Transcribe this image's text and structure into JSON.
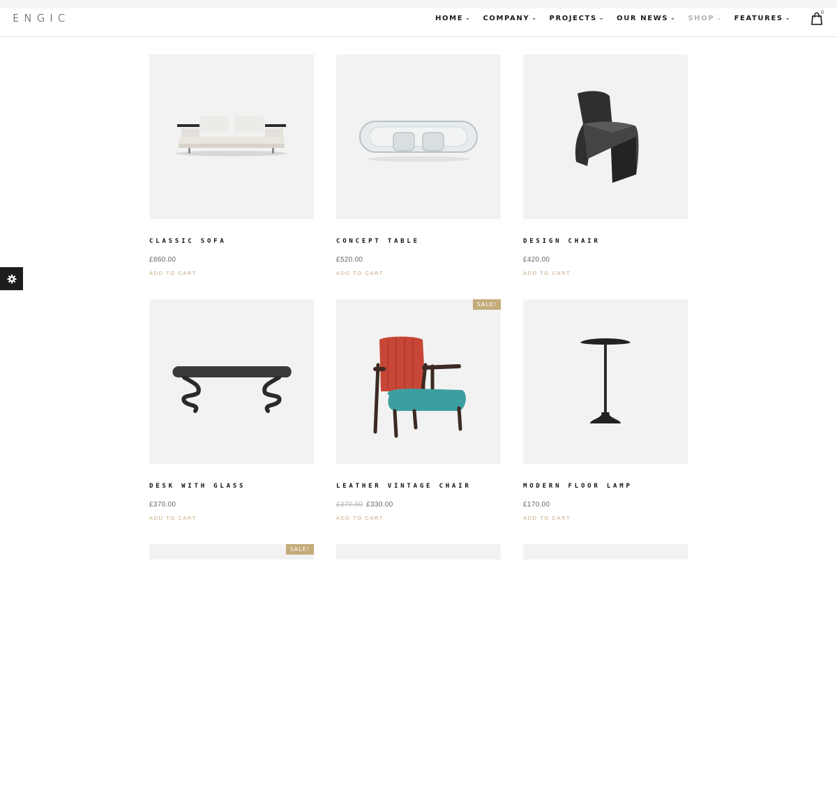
{
  "header": {
    "logo": "ENGIC",
    "nav": [
      {
        "label": "HOME",
        "active": false
      },
      {
        "label": "COMPANY",
        "active": false
      },
      {
        "label": "PROJECTS",
        "active": false
      },
      {
        "label": "OUR NEWS",
        "active": false
      },
      {
        "label": "SHOP",
        "active": true
      },
      {
        "label": "FEATURES",
        "active": false
      }
    ],
    "cart_count": "0",
    "cart_icon": "shopping-bag-icon"
  },
  "sidebar": {
    "settings_icon": "gear-icon"
  },
  "products": [
    {
      "name": "CLASSIC SOFA",
      "price": "£860.00",
      "old_price": "",
      "action": "ADD TO CART",
      "sale": "",
      "image": "sofa"
    },
    {
      "name": "CONCEPT TABLE",
      "price": "£520.00",
      "old_price": "",
      "action": "ADD TO CART",
      "sale": "",
      "image": "glass-table"
    },
    {
      "name": "DESIGN CHAIR",
      "price": "£420.00",
      "old_price": "",
      "action": "ADD TO CART",
      "sale": "",
      "image": "chair"
    },
    {
      "name": "DESK WITH GLASS",
      "price": "£370.00",
      "old_price": "",
      "action": "ADD TO CART",
      "sale": "",
      "image": "desk"
    },
    {
      "name": "LEATHER VINTAGE CHAIR",
      "price": "£330.00",
      "old_price": "£370.00",
      "action": "ADD TO CART",
      "sale": "SALE!",
      "image": "armchair"
    },
    {
      "name": "MODERN FLOOR LAMP",
      "price": "£170.00",
      "old_price": "",
      "action": "ADD TO CART",
      "sale": "",
      "image": "lamp"
    }
  ],
  "partial_row": [
    {
      "sale": "SALE!"
    },
    {
      "sale": ""
    },
    {
      "sale": ""
    }
  ],
  "colors": {
    "accent": "#c3a77b",
    "sale_badge": "#c3ab7a",
    "thumb_bg": "#f2f2f2",
    "active_nav": "#b4b4b4"
  }
}
